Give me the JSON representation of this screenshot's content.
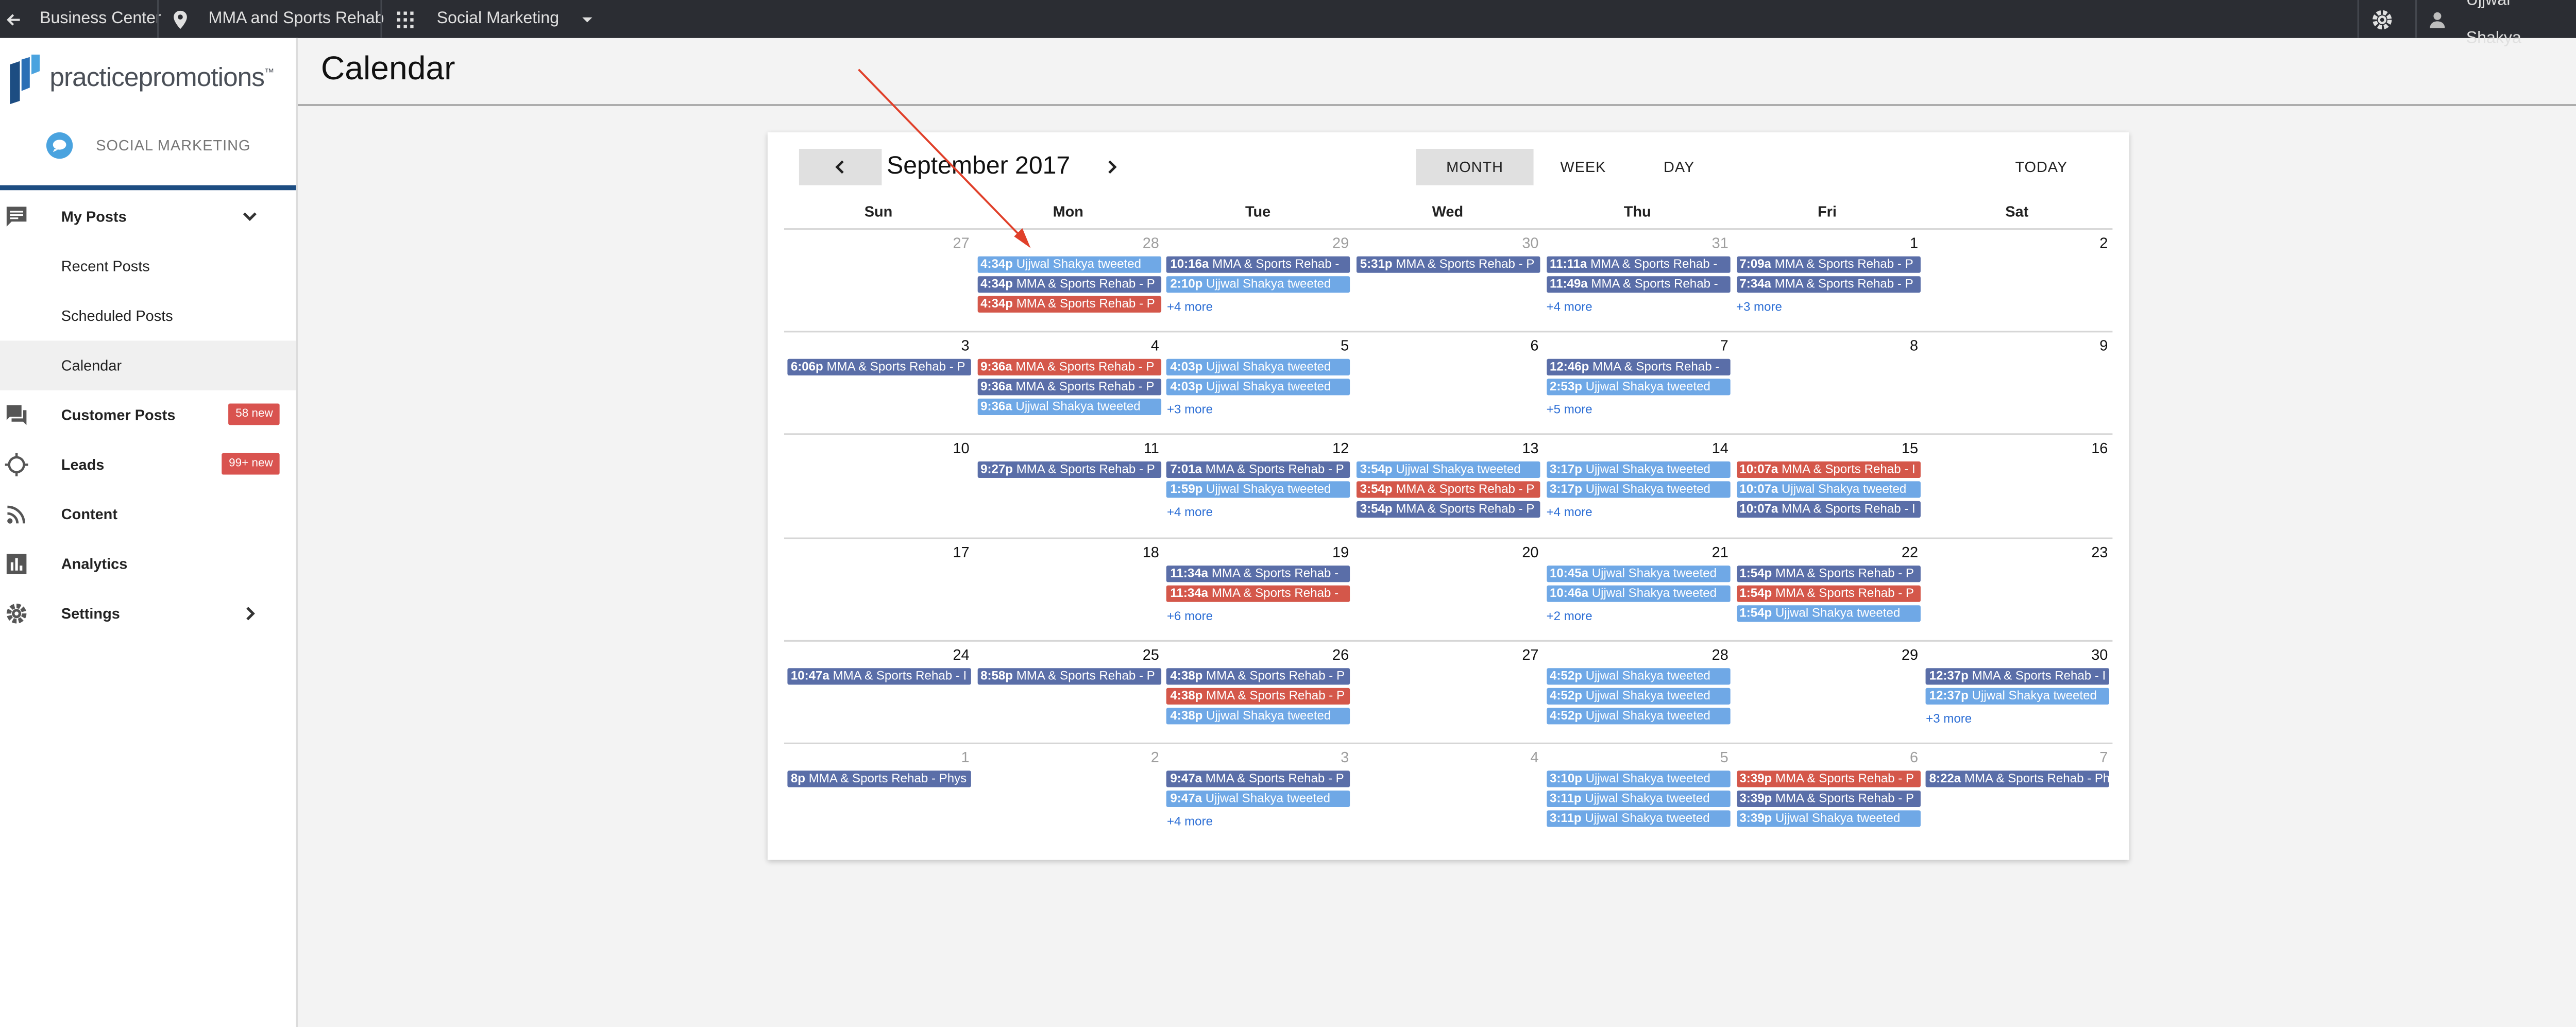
{
  "topbar": {
    "business_center": "Business Center",
    "location": "MMA and Sports Rehab",
    "product": "Social Marketing",
    "user": "Ujjwal Shakya"
  },
  "sidebar": {
    "logo_text": "practicepromotions",
    "logo_tm": "™",
    "product_label": "SOCIAL MARKETING",
    "items": [
      {
        "label": "My Posts",
        "badge": "",
        "icon": "comment-icon"
      },
      {
        "label": "Recent Posts",
        "badge": ""
      },
      {
        "label": "Scheduled Posts",
        "badge": ""
      },
      {
        "label": "Calendar",
        "badge": ""
      },
      {
        "label": "Customer Posts",
        "badge": "58 new",
        "icon": "forum-icon"
      },
      {
        "label": "Leads",
        "badge": "99+ new",
        "icon": "crosshair-icon"
      },
      {
        "label": "Content",
        "badge": "",
        "icon": "rss-icon"
      },
      {
        "label": "Analytics",
        "badge": "",
        "icon": "bar-chart-icon"
      },
      {
        "label": "Settings",
        "badge": "",
        "icon": "gear-icon"
      }
    ]
  },
  "page_title": "Calendar",
  "calendar": {
    "month_label": "September 2017",
    "views": {
      "month": "MONTH",
      "week": "WEEK",
      "day": "DAY",
      "today": "TODAY"
    },
    "selected_view": "MONTH",
    "dow": [
      "Sun",
      "Mon",
      "Tue",
      "Wed",
      "Thu",
      "Fri",
      "Sat"
    ],
    "colors": {
      "scheduled_dark": "#5a6ea8",
      "tweet_light": "#6fa8e6",
      "failed_red": "#d4574a"
    },
    "weeks": [
      [
        {
          "day": "27",
          "other": true,
          "events": [],
          "more": ""
        },
        {
          "day": "28",
          "other": true,
          "events": [
            {
              "time": "4:34p",
              "text": "Ujjwal Shakya tweeted",
              "kind": "light"
            },
            {
              "time": "4:34p",
              "text": "MMA & Sports Rehab - P",
              "kind": "dark"
            },
            {
              "time": "4:34p",
              "text": "MMA & Sports Rehab - P",
              "kind": "red"
            }
          ],
          "more": ""
        },
        {
          "day": "29",
          "other": true,
          "events": [
            {
              "time": "10:16a",
              "text": "MMA & Sports Rehab -",
              "kind": "dark"
            },
            {
              "time": "2:10p",
              "text": "Ujjwal Shakya tweeted",
              "kind": "light"
            }
          ],
          "more": "+4 more"
        },
        {
          "day": "30",
          "other": true,
          "events": [
            {
              "time": "5:31p",
              "text": "MMA & Sports Rehab - P",
              "kind": "dark"
            }
          ],
          "more": ""
        },
        {
          "day": "31",
          "other": true,
          "events": [
            {
              "time": "11:11a",
              "text": "MMA & Sports Rehab -",
              "kind": "dark"
            },
            {
              "time": "11:49a",
              "text": "MMA & Sports Rehab -",
              "kind": "dark"
            }
          ],
          "more": "+4 more"
        },
        {
          "day": "1",
          "other": false,
          "events": [
            {
              "time": "7:09a",
              "text": "MMA & Sports Rehab - P",
              "kind": "dark"
            },
            {
              "time": "7:34a",
              "text": "MMA & Sports Rehab - P",
              "kind": "dark"
            }
          ],
          "more": "+3 more"
        },
        {
          "day": "2",
          "other": false,
          "events": [],
          "more": ""
        }
      ],
      [
        {
          "day": "3",
          "other": false,
          "events": [
            {
              "time": "6:06p",
              "text": "MMA & Sports Rehab - P",
              "kind": "dark"
            }
          ],
          "more": ""
        },
        {
          "day": "4",
          "other": false,
          "events": [
            {
              "time": "9:36a",
              "text": "MMA & Sports Rehab - P",
              "kind": "red"
            },
            {
              "time": "9:36a",
              "text": "MMA & Sports Rehab - P",
              "kind": "dark"
            },
            {
              "time": "9:36a",
              "text": "Ujjwal Shakya tweeted",
              "kind": "light"
            }
          ],
          "more": ""
        },
        {
          "day": "5",
          "other": false,
          "events": [
            {
              "time": "4:03p",
              "text": "Ujjwal Shakya tweeted",
              "kind": "light"
            },
            {
              "time": "4:03p",
              "text": "Ujjwal Shakya tweeted",
              "kind": "light"
            }
          ],
          "more": "+3 more"
        },
        {
          "day": "6",
          "other": false,
          "events": [],
          "more": ""
        },
        {
          "day": "7",
          "other": false,
          "events": [
            {
              "time": "12:46p",
              "text": "MMA & Sports Rehab -",
              "kind": "dark"
            },
            {
              "time": "2:53p",
              "text": "Ujjwal Shakya tweeted",
              "kind": "light"
            }
          ],
          "more": "+5 more"
        },
        {
          "day": "8",
          "other": false,
          "events": [],
          "more": ""
        },
        {
          "day": "9",
          "other": false,
          "events": [],
          "more": ""
        }
      ],
      [
        {
          "day": "10",
          "other": false,
          "events": [],
          "more": ""
        },
        {
          "day": "11",
          "other": false,
          "events": [
            {
              "time": "9:27p",
              "text": "MMA & Sports Rehab - P",
              "kind": "dark"
            }
          ],
          "more": ""
        },
        {
          "day": "12",
          "other": false,
          "events": [
            {
              "time": "7:01a",
              "text": "MMA & Sports Rehab - P",
              "kind": "dark"
            },
            {
              "time": "1:59p",
              "text": "Ujjwal Shakya tweeted",
              "kind": "light"
            }
          ],
          "more": "+4 more"
        },
        {
          "day": "13",
          "other": false,
          "events": [
            {
              "time": "3:54p",
              "text": "Ujjwal Shakya tweeted",
              "kind": "light"
            },
            {
              "time": "3:54p",
              "text": "MMA & Sports Rehab - P",
              "kind": "red"
            },
            {
              "time": "3:54p",
              "text": "MMA & Sports Rehab - P",
              "kind": "dark"
            }
          ],
          "more": ""
        },
        {
          "day": "14",
          "other": false,
          "events": [
            {
              "time": "3:17p",
              "text": "Ujjwal Shakya tweeted",
              "kind": "light"
            },
            {
              "time": "3:17p",
              "text": "Ujjwal Shakya tweeted",
              "kind": "light"
            }
          ],
          "more": "+4 more"
        },
        {
          "day": "15",
          "other": false,
          "events": [
            {
              "time": "10:07a",
              "text": "MMA & Sports Rehab - I",
              "kind": "red"
            },
            {
              "time": "10:07a",
              "text": "Ujjwal Shakya tweeted",
              "kind": "light"
            },
            {
              "time": "10:07a",
              "text": "MMA & Sports Rehab - I",
              "kind": "dark"
            }
          ],
          "more": ""
        },
        {
          "day": "16",
          "other": false,
          "events": [],
          "more": ""
        }
      ],
      [
        {
          "day": "17",
          "other": false,
          "events": [],
          "more": ""
        },
        {
          "day": "18",
          "other": false,
          "events": [],
          "more": ""
        },
        {
          "day": "19",
          "other": false,
          "events": [
            {
              "time": "11:34a",
              "text": "MMA & Sports Rehab -",
              "kind": "dark"
            },
            {
              "time": "11:34a",
              "text": "MMA & Sports Rehab -",
              "kind": "red"
            }
          ],
          "more": "+6 more"
        },
        {
          "day": "20",
          "other": false,
          "events": [],
          "more": ""
        },
        {
          "day": "21",
          "other": false,
          "events": [
            {
              "time": "10:45a",
              "text": "Ujjwal Shakya tweeted",
              "kind": "light"
            },
            {
              "time": "10:46a",
              "text": "Ujjwal Shakya tweeted",
              "kind": "light"
            }
          ],
          "more": "+2 more"
        },
        {
          "day": "22",
          "other": false,
          "events": [
            {
              "time": "1:54p",
              "text": "MMA & Sports Rehab - P",
              "kind": "dark"
            },
            {
              "time": "1:54p",
              "text": "MMA & Sports Rehab - P",
              "kind": "red"
            },
            {
              "time": "1:54p",
              "text": "Ujjwal Shakya tweeted",
              "kind": "light"
            }
          ],
          "more": ""
        },
        {
          "day": "23",
          "other": false,
          "events": [],
          "more": ""
        }
      ],
      [
        {
          "day": "24",
          "other": false,
          "events": [
            {
              "time": "10:47a",
              "text": "MMA & Sports Rehab - I",
              "kind": "dark"
            }
          ],
          "more": ""
        },
        {
          "day": "25",
          "other": false,
          "events": [
            {
              "time": "8:58p",
              "text": "MMA & Sports Rehab - P",
              "kind": "dark"
            }
          ],
          "more": ""
        },
        {
          "day": "26",
          "other": false,
          "events": [
            {
              "time": "4:38p",
              "text": "MMA & Sports Rehab - P",
              "kind": "dark"
            },
            {
              "time": "4:38p",
              "text": "MMA & Sports Rehab - P",
              "kind": "red"
            },
            {
              "time": "4:38p",
              "text": "Ujjwal Shakya tweeted",
              "kind": "light"
            }
          ],
          "more": ""
        },
        {
          "day": "27",
          "other": false,
          "events": [],
          "more": ""
        },
        {
          "day": "28",
          "other": false,
          "events": [
            {
              "time": "4:52p",
              "text": "Ujjwal Shakya tweeted",
              "kind": "light"
            },
            {
              "time": "4:52p",
              "text": "Ujjwal Shakya tweeted",
              "kind": "light"
            },
            {
              "time": "4:52p",
              "text": "Ujjwal Shakya tweeted",
              "kind": "light"
            }
          ],
          "more": ""
        },
        {
          "day": "29",
          "other": false,
          "events": [],
          "more": ""
        },
        {
          "day": "30",
          "other": false,
          "events": [
            {
              "time": "12:37p",
              "text": "MMA & Sports Rehab - I",
              "kind": "dark"
            },
            {
              "time": "12:37p",
              "text": "Ujjwal Shakya tweeted",
              "kind": "light"
            }
          ],
          "more": "+3 more"
        }
      ],
      [
        {
          "day": "1",
          "other": true,
          "events": [
            {
              "time": "8p",
              "text": "MMA & Sports Rehab - Phys",
              "kind": "dark"
            }
          ],
          "more": ""
        },
        {
          "day": "2",
          "other": true,
          "events": [],
          "more": ""
        },
        {
          "day": "3",
          "other": true,
          "events": [
            {
              "time": "9:47a",
              "text": "MMA & Sports Rehab - P",
              "kind": "dark"
            },
            {
              "time": "9:47a",
              "text": "Ujjwal Shakya tweeted",
              "kind": "light"
            }
          ],
          "more": "+4 more"
        },
        {
          "day": "4",
          "other": true,
          "events": [],
          "more": ""
        },
        {
          "day": "5",
          "other": true,
          "events": [
            {
              "time": "3:10p",
              "text": "Ujjwal Shakya tweeted",
              "kind": "light"
            },
            {
              "time": "3:11p",
              "text": "Ujjwal Shakya tweeted",
              "kind": "light"
            },
            {
              "time": "3:11p",
              "text": "Ujjwal Shakya tweeted",
              "kind": "light"
            }
          ],
          "more": ""
        },
        {
          "day": "6",
          "other": true,
          "events": [
            {
              "time": "3:39p",
              "text": "MMA & Sports Rehab - P",
              "kind": "red"
            },
            {
              "time": "3:39p",
              "text": "MMA & Sports Rehab - P",
              "kind": "dark"
            },
            {
              "time": "3:39p",
              "text": "Ujjwal Shakya tweeted",
              "kind": "light"
            }
          ],
          "more": ""
        },
        {
          "day": "7",
          "other": true,
          "events": [
            {
              "time": "8:22a",
              "text": "MMA & Sports Rehab - Ph",
              "kind": "dark"
            }
          ],
          "more": ""
        }
      ]
    ]
  }
}
